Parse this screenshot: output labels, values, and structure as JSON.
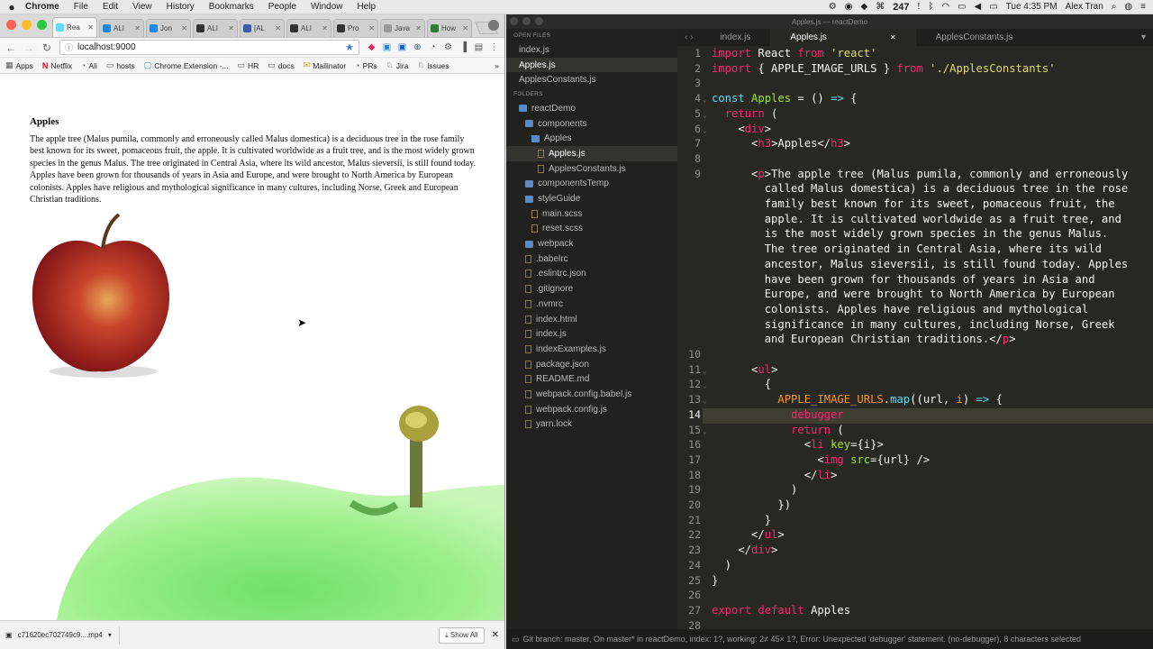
{
  "menubar": {
    "app": "Chrome",
    "items": [
      "File",
      "Edit",
      "View",
      "History",
      "Bookmarks",
      "People",
      "Window",
      "Help"
    ],
    "badge": "247",
    "clock": "Tue 4:35 PM",
    "user": "Alex Tran"
  },
  "browser": {
    "tabs": [
      {
        "label": "Rea",
        "color": "#61dafb"
      },
      {
        "label": "ALI",
        "color": "#1e88e5"
      },
      {
        "label": "Jon",
        "color": "#1e88e5"
      },
      {
        "label": "ALI",
        "color": "#333333"
      },
      {
        "label": "[AL",
        "color": "#3b5ba5"
      },
      {
        "label": "ALI",
        "color": "#333333"
      },
      {
        "label": "Pro",
        "color": "#333333"
      },
      {
        "label": "Java",
        "color": "#999999"
      },
      {
        "label": "How",
        "color": "#2e7d32"
      }
    ],
    "url": "localhost:9000",
    "bookmarks": [
      "Apps",
      "Netflix",
      "Ali",
      "hosts",
      "Chrome Extension -...",
      "HR",
      "docs",
      "Mailinator",
      "PRs",
      "Jira",
      "issues"
    ],
    "download": {
      "filename": "c71620ec702749c9....mp4",
      "show_all": "Show All"
    }
  },
  "page": {
    "heading": "Apples",
    "paragraph": "The apple tree (Malus pumila, commonly and erroneously called Malus domestica) is a deciduous tree in the rose family best known for its sweet, pomaceous fruit, the apple. It is cultivated worldwide as a fruit tree, and is the most widely grown species in the genus Malus. The tree originated in Central Asia, where its wild ancestor, Malus sieversii, is still found today. Apples have been grown for thousands of years in Asia and Europe, and were brought to North America by European colonists. Apples have religious and mythological significance in many cultures, including Norse, Greek and European Christian traditions."
  },
  "editor": {
    "title": "Apples.js — reactDemo",
    "open_files_label": "OPEN FILES",
    "folders_label": "FOLDERS",
    "open_files": [
      "index.js",
      "Apples.js",
      "ApplesConstants.js"
    ],
    "tree": [
      {
        "name": "reactDemo",
        "depth": 0,
        "type": "folder"
      },
      {
        "name": "components",
        "depth": 1,
        "type": "folder"
      },
      {
        "name": "Apples",
        "depth": 2,
        "type": "folder"
      },
      {
        "name": "Apples.js",
        "depth": 3,
        "type": "file",
        "selected": true
      },
      {
        "name": "ApplesConstants.js",
        "depth": 3,
        "type": "file"
      },
      {
        "name": "componentsTemp",
        "depth": 1,
        "type": "folder"
      },
      {
        "name": "styleGuide",
        "depth": 1,
        "type": "folder"
      },
      {
        "name": "main.scss",
        "depth": 2,
        "type": "file"
      },
      {
        "name": "reset.scss",
        "depth": 2,
        "type": "file"
      },
      {
        "name": "webpack",
        "depth": 1,
        "type": "folder"
      },
      {
        "name": ".babelrc",
        "depth": 1,
        "type": "file"
      },
      {
        "name": ".eslintrc.json",
        "depth": 1,
        "type": "file"
      },
      {
        "name": ".gitignore",
        "depth": 1,
        "type": "file"
      },
      {
        "name": ".nvmrc",
        "depth": 1,
        "type": "file"
      },
      {
        "name": "index.html",
        "depth": 1,
        "type": "file"
      },
      {
        "name": "index.js",
        "depth": 1,
        "type": "file"
      },
      {
        "name": "indexExamples.js",
        "depth": 1,
        "type": "file"
      },
      {
        "name": "package.json",
        "depth": 1,
        "type": "file"
      },
      {
        "name": "README.md",
        "depth": 1,
        "type": "file"
      },
      {
        "name": "webpack.config.babel.js",
        "depth": 1,
        "type": "file"
      },
      {
        "name": "webpack.config.js",
        "depth": 1,
        "type": "file"
      },
      {
        "name": "yarn.lock",
        "depth": 1,
        "type": "file"
      }
    ],
    "tabs": [
      "index.js",
      "Apples.js",
      "ApplesConstants.js"
    ],
    "active_tab": "Apples.js",
    "current_line": "14",
    "status": "Git branch: master, On master* in reactDemo, index: 1?, working: 2≠ 45× 1?, Error: Unexpected 'debugger' statement. (no-debugger), 8 characters selected"
  }
}
